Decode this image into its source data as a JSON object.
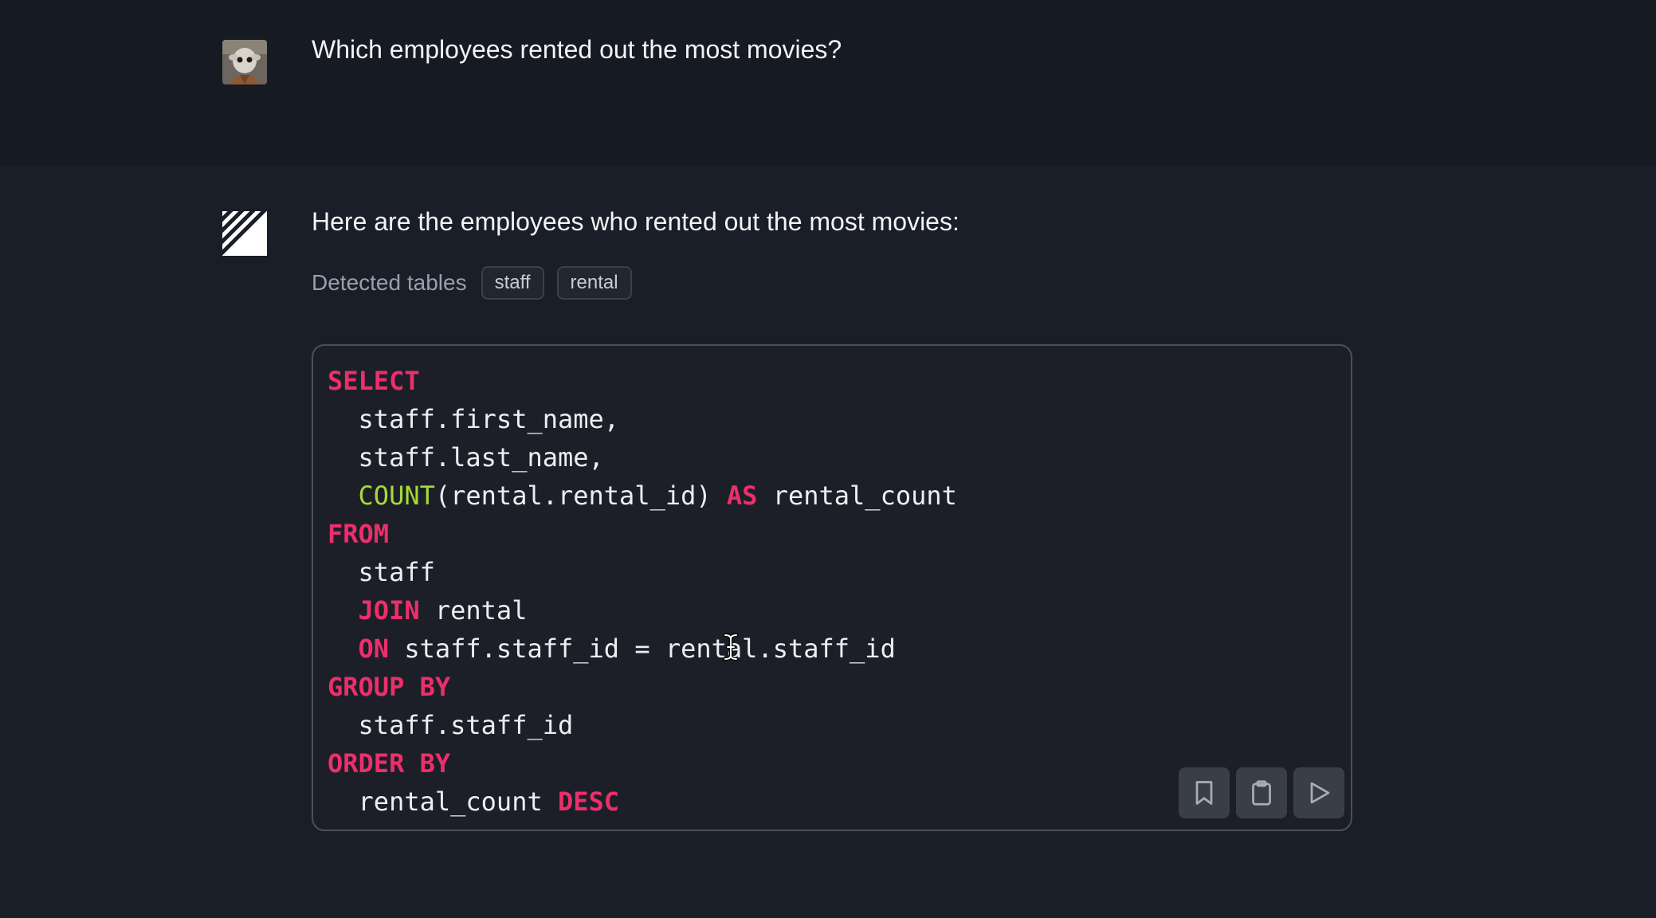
{
  "conversation": {
    "user_message": "Which employees rented out the most movies?",
    "assistant_message": "Here are the employees who rented out the most movies:",
    "detected_tables_label": "Detected tables",
    "detected_tables": [
      "staff",
      "rental"
    ]
  },
  "code": {
    "lines": [
      [
        {
          "t": "SELECT",
          "c": "kw"
        }
      ],
      [
        {
          "t": "  staff.first_name,",
          "c": "tx"
        }
      ],
      [
        {
          "t": "  staff.last_name,",
          "c": "tx"
        }
      ],
      [
        {
          "t": "  ",
          "c": "tx"
        },
        {
          "t": "COUNT",
          "c": "fn"
        },
        {
          "t": "(rental.rental_id) ",
          "c": "tx"
        },
        {
          "t": "AS",
          "c": "kw"
        },
        {
          "t": " rental_count",
          "c": "tx"
        }
      ],
      [
        {
          "t": "FROM",
          "c": "kw"
        }
      ],
      [
        {
          "t": "  staff",
          "c": "tx"
        }
      ],
      [
        {
          "t": "  ",
          "c": "tx"
        },
        {
          "t": "JOIN",
          "c": "kw"
        },
        {
          "t": " rental",
          "c": "tx"
        }
      ],
      [
        {
          "t": "  ",
          "c": "tx"
        },
        {
          "t": "ON",
          "c": "kw"
        },
        {
          "t": " staff.staff_id = rental.staff_id",
          "c": "tx"
        }
      ],
      [
        {
          "t": "GROUP BY",
          "c": "kw"
        }
      ],
      [
        {
          "t": "  staff.staff_id",
          "c": "tx"
        }
      ],
      [
        {
          "t": "ORDER BY",
          "c": "kw"
        }
      ],
      [
        {
          "t": "  rental_count ",
          "c": "tx"
        },
        {
          "t": "DESC",
          "c": "kw"
        }
      ]
    ],
    "actions": [
      {
        "icon": "bookmark-icon",
        "label": "Save query"
      },
      {
        "icon": "clipboard-icon",
        "label": "Copy query"
      },
      {
        "icon": "play-icon",
        "label": "Run query"
      }
    ]
  },
  "colors": {
    "keyword": "#ec2f6b",
    "function": "#a6d93a",
    "text": "#eceef2",
    "background": "#1a1e28"
  }
}
